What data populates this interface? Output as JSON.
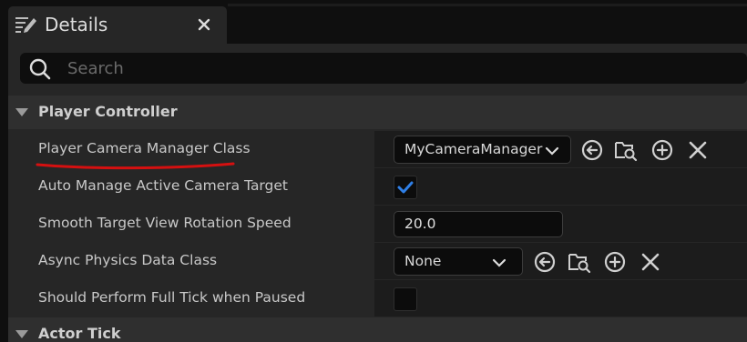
{
  "tab": {
    "title": "Details",
    "icon": "details-panel-icon",
    "close_icon": "close-icon"
  },
  "search": {
    "placeholder": "Search",
    "value": ""
  },
  "categories": [
    {
      "label": "Player Controller",
      "expanded": true,
      "properties": [
        {
          "label": "Player Camera Manager Class",
          "type": "class-picker",
          "value": "MyCameraManager",
          "icons": [
            "browse-back-icon",
            "browse-folder-icon",
            "add-icon",
            "clear-icon"
          ],
          "annotation": "red-underline"
        },
        {
          "label": "Auto Manage Active Camera Target",
          "type": "checkbox",
          "checked": true
        },
        {
          "label": "Smooth Target View Rotation Speed",
          "type": "number",
          "value": "20.0"
        },
        {
          "label": "Async Physics Data Class",
          "type": "class-picker",
          "value": "None",
          "icons": [
            "browse-back-icon",
            "browse-folder-icon",
            "add-icon",
            "clear-icon"
          ]
        },
        {
          "label": "Should Perform Full Tick when Paused",
          "type": "checkbox",
          "checked": false
        }
      ]
    },
    {
      "label": "Actor Tick",
      "expanded": true
    }
  ],
  "colors": {
    "checkbox_accent": "#2f7fe6",
    "annotation": "#d51010"
  }
}
